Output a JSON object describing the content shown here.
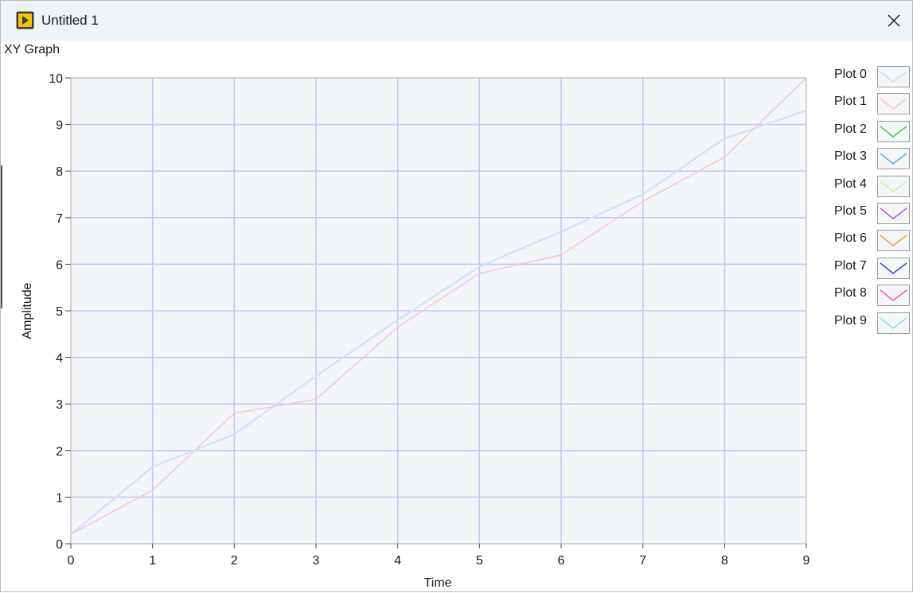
{
  "window": {
    "title": "Untitled 1",
    "close_glyph": "✕",
    "icon": "labview-vi-icon",
    "accent": "#f5c400"
  },
  "graph": {
    "label": "XY Graph",
    "plot_background": "#f3f6f8",
    "grid_color": "#c4c4ec"
  },
  "chart_data": {
    "type": "line",
    "title": "",
    "xlabel": "Time",
    "ylabel": "Amplitude",
    "xlim": [
      0,
      9
    ],
    "ylim": [
      0,
      10
    ],
    "x_ticks": [
      0,
      1,
      2,
      3,
      4,
      5,
      6,
      7,
      8,
      9
    ],
    "y_ticks": [
      0,
      1,
      2,
      3,
      4,
      5,
      6,
      7,
      8,
      9,
      10
    ],
    "grid": true,
    "legend_position": "right",
    "series": [
      {
        "name": "Plot 0",
        "color": "#d2e0fc",
        "x": [
          0,
          1,
          2,
          3,
          4,
          5,
          6,
          7,
          8,
          9
        ],
        "y": [
          0.2,
          1.65,
          2.35,
          3.6,
          4.8,
          5.95,
          6.7,
          7.5,
          8.7,
          9.3
        ]
      },
      {
        "name": "Plot 1",
        "color": "#f7c2d4",
        "x": [
          0,
          1,
          2,
          3,
          4,
          5,
          6,
          7,
          8,
          9
        ],
        "y": [
          0.2,
          1.15,
          2.8,
          3.1,
          4.65,
          5.8,
          6.2,
          7.35,
          8.3,
          10.0
        ]
      }
    ]
  },
  "legend": {
    "items": [
      {
        "name": "Plot 0",
        "color": "#c9d8f8"
      },
      {
        "name": "Plot 1",
        "color": "#f6bfd0"
      },
      {
        "name": "Plot 2",
        "color": "#22cc22"
      },
      {
        "name": "Plot 3",
        "color": "#33aaee"
      },
      {
        "name": "Plot 4",
        "color": "#c6f0a8"
      },
      {
        "name": "Plot 5",
        "color": "#aa44cc"
      },
      {
        "name": "Plot 6",
        "color": "#ee9922"
      },
      {
        "name": "Plot 7",
        "color": "#2233bb"
      },
      {
        "name": "Plot 8",
        "color": "#ee44aa"
      },
      {
        "name": "Plot 9",
        "color": "#66e8ee"
      }
    ]
  }
}
